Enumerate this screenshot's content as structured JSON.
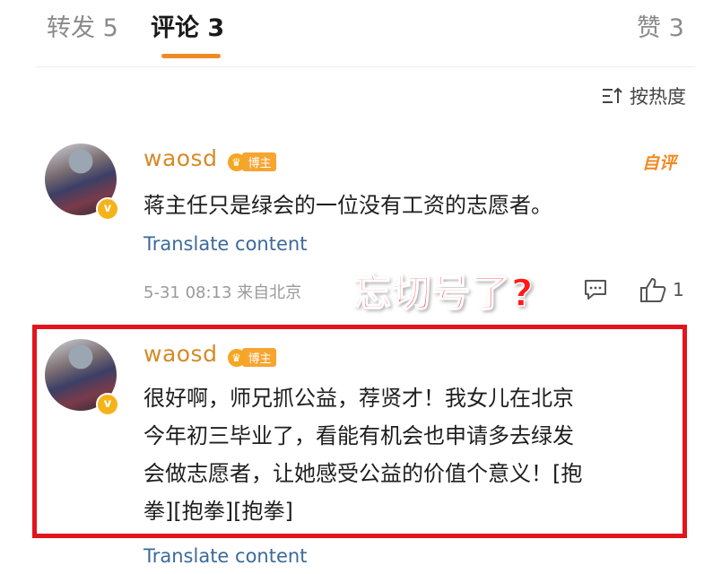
{
  "tabs": {
    "repost": "转发 5",
    "comment": "评论 3",
    "like": "赞 3"
  },
  "sort": {
    "label": "按热度",
    "icon": "sort-icon"
  },
  "comments": [
    {
      "username": "waosd",
      "badge": "博主",
      "author_tag": "自评",
      "text": "蒋主任只是绿会的一位没有工资的志愿者。",
      "translate": "Translate content",
      "meta": "5-31 08:13 来自北京",
      "like_count": "1"
    },
    {
      "username": "waosd",
      "badge": "博主",
      "text_lines": [
        "很好啊，师兄抓公益，荐贤才！我女儿在北京",
        "今年初三毕业了，看能有机会也申请多去绿发",
        "会做志愿者，让她感受公益的价值个意义！[抱",
        "拳][抱拳][抱拳]"
      ],
      "translate": "Translate content"
    }
  ],
  "overlay_text": "忘切号了?",
  "colors": {
    "accent": "#f08a24",
    "username": "#d58a26",
    "translate": "#3b6a9b",
    "highlight": "#e3141b"
  }
}
